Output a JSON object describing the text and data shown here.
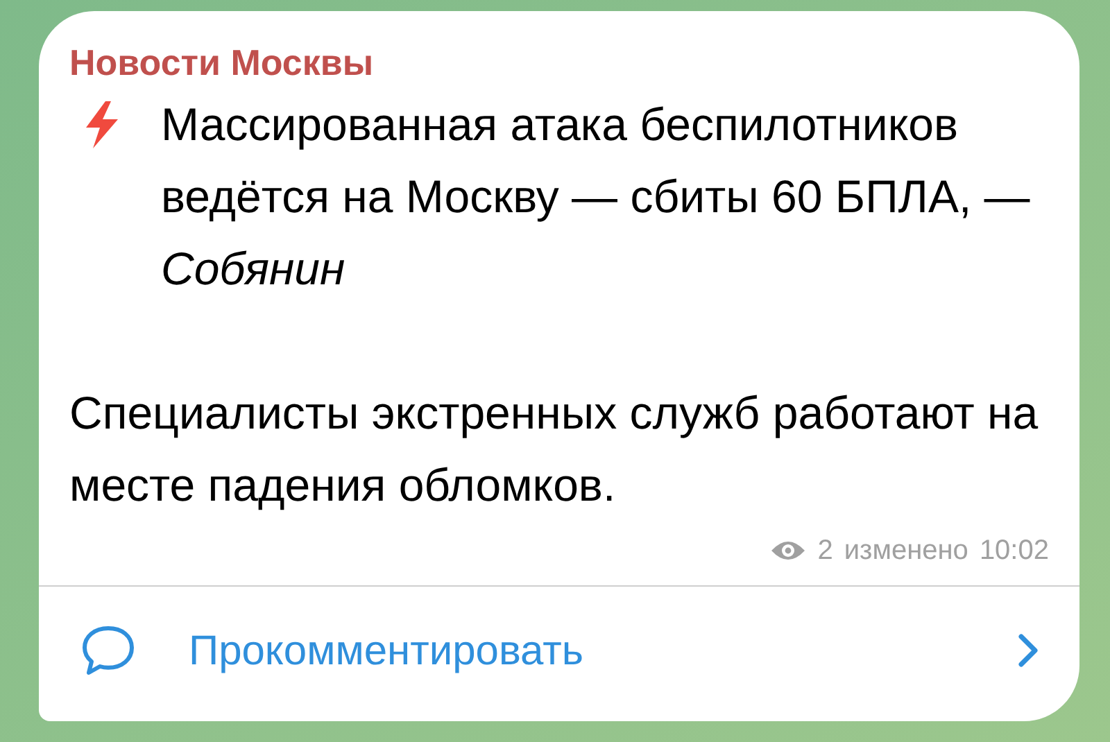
{
  "channel": {
    "name": "Новости Москвы"
  },
  "message": {
    "paragraphs": [
      "Массированная атака беспилотников ведётся на Москву — сбиты 60 БПЛА, — *Собянин*",
      "Специалисты экстренных служб работают на месте падения обломков."
    ],
    "views": "2",
    "edited": "изменено",
    "time": "10:02"
  },
  "comment_button": {
    "label": "Прокомментировать"
  }
}
